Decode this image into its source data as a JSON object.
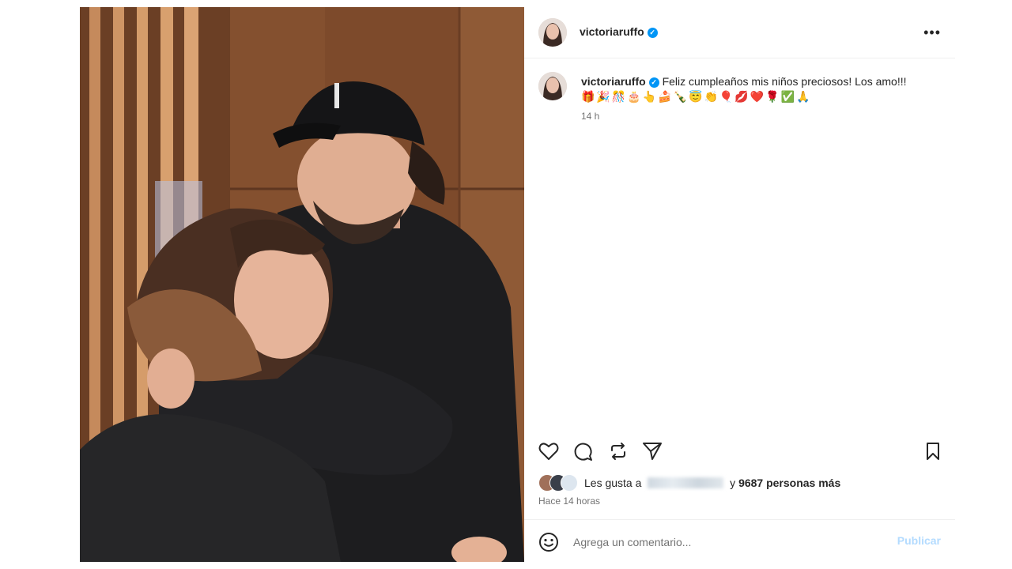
{
  "post": {
    "username": "victoriaruffo",
    "caption_text": "Feliz cumpleaños mis niños preciosos! Los amo!!!",
    "caption_emojis": "🎁🎉🎊🎂👆🍰🍾😇👏🎈💋❤️🌹✅🙏",
    "time_short": "14 h",
    "likes_prefix": "Les gusta a",
    "likes_conjunction": "y",
    "likes_count": "9687 personas más",
    "time_long": "Hace 14 horas"
  },
  "comment": {
    "placeholder": "Agrega un comentario...",
    "publish_label": "Publicar"
  },
  "icons": {
    "more": "more-options-icon",
    "like": "heart-icon",
    "comment": "comment-icon",
    "share": "repost-icon",
    "send": "send-icon",
    "save": "bookmark-icon",
    "emoji": "emoji-icon",
    "verified": "verified-badge-icon"
  },
  "colors": {
    "verified": "#0095f6",
    "publish_disabled": "#b3dbff",
    "secondary_text": "#737373"
  }
}
